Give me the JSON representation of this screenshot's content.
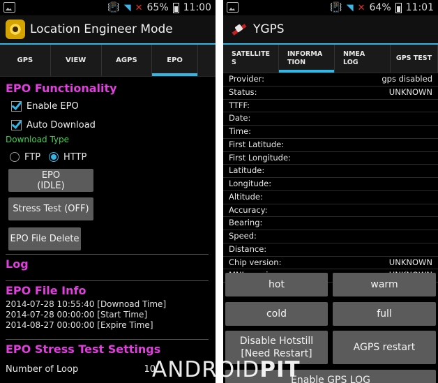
{
  "left": {
    "status": {
      "percent": "65%",
      "time": "11:00"
    },
    "app_title": "Location Engineer Mode",
    "tabs": [
      "GPS",
      "VIEW",
      "AGPS",
      "EPO"
    ],
    "epo_functionality": {
      "title": "EPO Functionality",
      "enable_epo": "Enable EPO",
      "auto_download": "Auto Download",
      "download_type_label": "Download Type",
      "ftp": "FTP",
      "http": "HTTP",
      "epo_button_line1": "EPO",
      "epo_button_line2": "(IDLE)",
      "stress_test_button": "Stress Test (OFF)",
      "file_delete_button": "EPO File Delete"
    },
    "log_title": "Log",
    "file_info": {
      "title": "EPO File Info",
      "lines": [
        "2014-07-28 10:55:40 [Downoad Time]",
        "2014-07-28 00:00:00 [Start Time]",
        "2014-08-27 00:00:00 [Expire Time]"
      ]
    },
    "stress_settings": {
      "title": "EPO Stress Test Settings",
      "number_of_loop_label": "Number of Loop",
      "number_of_loop_value": "10"
    }
  },
  "right": {
    "status": {
      "percent": "64%",
      "time": "11:01"
    },
    "app_title": "YGPS",
    "tabs": [
      {
        "line1": "SATELLITE",
        "line2": "S"
      },
      {
        "line1": "INFORMA",
        "line2": "TION"
      },
      {
        "line1": "NMEA",
        "line2": "LOG"
      },
      {
        "line1": "GPS TEST",
        "line2": ""
      }
    ],
    "rows": [
      {
        "label": "Provider:",
        "value": "gps disabled"
      },
      {
        "label": "Status:",
        "value": "UNKNOWN"
      },
      {
        "label": "TTFF:",
        "value": ""
      },
      {
        "label": "Date:",
        "value": ""
      },
      {
        "label": "Time:",
        "value": ""
      },
      {
        "label": "First Latitude:",
        "value": ""
      },
      {
        "label": "First Longitude:",
        "value": ""
      },
      {
        "label": "Latitude:",
        "value": ""
      },
      {
        "label": "Longitude:",
        "value": ""
      },
      {
        "label": "Altitude:",
        "value": ""
      },
      {
        "label": "Accuracy:",
        "value": ""
      },
      {
        "label": "Bearing:",
        "value": ""
      },
      {
        "label": "Speed:",
        "value": ""
      },
      {
        "label": "Distance:",
        "value": ""
      },
      {
        "label": "Chip version:",
        "value": "UNKNOWN"
      },
      {
        "label": "MNL version:",
        "value": "UNKNOWN"
      }
    ],
    "buttons": {
      "hot": "hot",
      "warm": "warm",
      "cold": "cold",
      "full": "full",
      "disable_hotstill_line1": "Disable Hotstill",
      "disable_hotstill_line2": "[Need Restart]",
      "agps_restart": "AGPS restart",
      "enable_gps_log": "Enable GPS LOG"
    }
  },
  "watermark": {
    "part1": "ANDROID",
    "part2": "PIT"
  },
  "colors": {
    "accent": "#33b5e5",
    "section_title": "#e23ee0",
    "subtitle": "#3fd34f",
    "button": "#5b5b5b"
  }
}
